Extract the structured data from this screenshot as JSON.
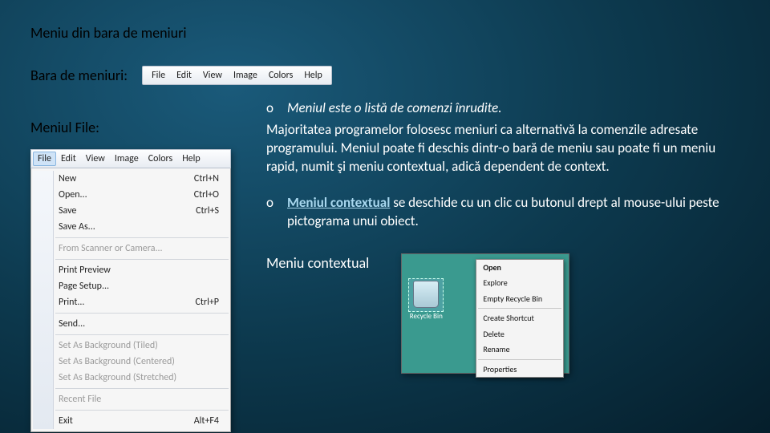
{
  "title": "Meniu din bara de meniuri",
  "row2_label": "Bara de meniuri:",
  "menubar": [
    "File",
    "Edit",
    "View",
    "Image",
    "Colors",
    "Help"
  ],
  "file_label": "Meniul File:",
  "filemenu_bar": [
    "File",
    "Edit",
    "View",
    "Image",
    "Colors",
    "Help"
  ],
  "filemenu_items": [
    {
      "label": "New",
      "accel": "Ctrl+N",
      "dis": false
    },
    {
      "label": "Open...",
      "accel": "Ctrl+O",
      "dis": false
    },
    {
      "label": "Save",
      "accel": "Ctrl+S",
      "dis": false
    },
    {
      "label": "Save As...",
      "accel": "",
      "dis": false
    },
    {
      "sep": true
    },
    {
      "label": "From Scanner or Camera...",
      "accel": "",
      "dis": true
    },
    {
      "sep": true
    },
    {
      "label": "Print Preview",
      "accel": "",
      "dis": false
    },
    {
      "label": "Page Setup...",
      "accel": "",
      "dis": false
    },
    {
      "label": "Print...",
      "accel": "Ctrl+P",
      "dis": false
    },
    {
      "sep": true
    },
    {
      "label": "Send...",
      "accel": "",
      "dis": false
    },
    {
      "sep": true
    },
    {
      "label": "Set As Background (Tiled)",
      "accel": "",
      "dis": true
    },
    {
      "label": "Set As Background (Centered)",
      "accel": "",
      "dis": true
    },
    {
      "label": "Set As Background (Stretched)",
      "accel": "",
      "dis": true
    },
    {
      "sep": true
    },
    {
      "label": "Recent File",
      "accel": "",
      "dis": true
    },
    {
      "sep": true
    },
    {
      "label": "Exit",
      "accel": "Alt+F4",
      "dis": false
    }
  ],
  "bullet1_o": "o",
  "bullet1_text": "Meniul este o listă de comenzi înrudite.",
  "para1": "Majoritatea programelor folosesc meniuri ca alternativă la comenzile adresate programului. Meniul poate fi deschis dintr-o bară de meniu sau poate fi un meniu rapid, numit şi meniu contextual, adică dependent de context.",
  "bullet2_o": "o",
  "bullet2_bold": "Meniul contextual",
  "bullet2_rest": " se deschide cu un clic cu butonul drept al mouse-ului peste pictograma unui obiect.",
  "ctx_label": "Meniu contextual",
  "bin_label": "Recycle Bin",
  "ctxmenu_items": [
    {
      "label": "Open",
      "b": true
    },
    {
      "label": "Explore"
    },
    {
      "label": "Empty Recycle Bin"
    },
    {
      "sep": true
    },
    {
      "label": "Create Shortcut"
    },
    {
      "label": "Delete"
    },
    {
      "label": "Rename"
    },
    {
      "sep": true
    },
    {
      "label": "Properties"
    }
  ]
}
